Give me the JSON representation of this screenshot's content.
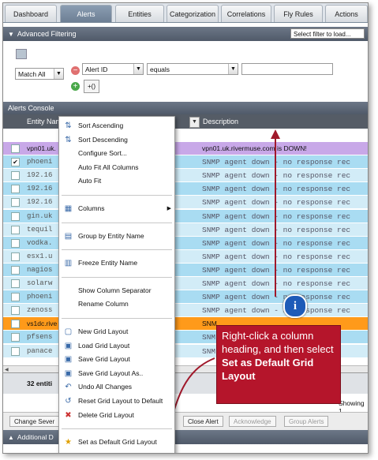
{
  "tabs": [
    "Dashboard",
    "Alerts",
    "Entities",
    "Categorization",
    "Correlations",
    "Fly Rules",
    "Actions"
  ],
  "active_tab": "Alerts",
  "advanced_filtering": {
    "title": "Advanced Filtering",
    "filter_select": "Select filter to load...",
    "match": "Match All",
    "field": "Alert ID",
    "operator": "equals",
    "value": "",
    "group_button": "+()"
  },
  "alerts_console": {
    "title": "Alerts Console",
    "columns": {
      "entity": "Entity Name",
      "description": "Description"
    },
    "rows": [
      {
        "entity": "vpn01.uk.",
        "desc": "vpn01.uk.rivermuse.com is DOWN!",
        "style": "purple",
        "checked": false
      },
      {
        "entity": "phoeni",
        "desc": "SNMP agent down - no response rec",
        "style": "blue",
        "checked": true
      },
      {
        "entity": "192.16",
        "desc": "SNMP agent down - no response rec",
        "style": "light",
        "checked": false
      },
      {
        "entity": "192.16",
        "desc": "SNMP agent down - no response rec",
        "style": "blue",
        "checked": false
      },
      {
        "entity": "192.16",
        "desc": "SNMP agent down - no response rec",
        "style": "light",
        "checked": false
      },
      {
        "entity": "gin.uk",
        "desc": "SNMP agent down - no response rec",
        "style": "blue",
        "checked": false
      },
      {
        "entity": "tequil",
        "desc": "SNMP agent down - no response rec",
        "style": "light",
        "checked": false
      },
      {
        "entity": "vodka.",
        "desc": "SNMP agent down - no response rec",
        "style": "blue",
        "checked": false
      },
      {
        "entity": "esx1.u",
        "desc": "SNMP agent down - no response rec",
        "style": "light",
        "checked": false
      },
      {
        "entity": "nagios",
        "desc": "SNMP agent down - no response rec",
        "style": "blue",
        "checked": false
      },
      {
        "entity": "solarw",
        "desc": "SNMP agent down - no response rec",
        "style": "light",
        "checked": false
      },
      {
        "entity": "phoeni",
        "desc": "SNMP agent down - no response rec",
        "style": "blue",
        "checked": false
      },
      {
        "entity": "zenoss",
        "desc": "SNMP agent down - no response rec",
        "style": "light",
        "checked": false
      },
      {
        "entity": "vs1dc.rive",
        "desc": "SNM",
        "style": "orange",
        "checked": false
      },
      {
        "entity": "pfsens",
        "desc": "SNM",
        "style": "blue",
        "checked": false
      },
      {
        "entity": "panace",
        "desc": "SNM",
        "style": "light",
        "checked": false
      }
    ],
    "entities_count": "32 entiti",
    "showing": "Showing 1"
  },
  "actions": {
    "change_severity": "Change Sever",
    "close_alert": "Close Alert",
    "acknowledge": "Acknowledge",
    "group_alerts": "Group Alerts"
  },
  "additional_bar": "Additional D",
  "context_menu": [
    {
      "label": "Sort Ascending",
      "icon": "sort-ascending-icon",
      "glyph": "⇅"
    },
    {
      "label": "Sort Descending",
      "icon": "sort-descending-icon",
      "glyph": "⇅"
    },
    {
      "label": "Configure Sort...",
      "icon": "",
      "glyph": ""
    },
    {
      "label": "Auto Fit All Columns",
      "icon": "",
      "glyph": ""
    },
    {
      "label": "Auto Fit",
      "icon": "",
      "glyph": ""
    },
    {
      "sep": true
    },
    {
      "label": "Columns",
      "icon": "columns-icon",
      "glyph": "▦",
      "submenu": true
    },
    {
      "sep": true
    },
    {
      "label": "Group by Entity Name",
      "icon": "group-icon",
      "glyph": "▤"
    },
    {
      "sep": true
    },
    {
      "label": "Freeze Entity Name",
      "icon": "freeze-icon",
      "glyph": "▥"
    },
    {
      "sep": true
    },
    {
      "label": "Show Column Separator",
      "icon": "",
      "glyph": ""
    },
    {
      "label": "Rename Column",
      "icon": "",
      "glyph": ""
    },
    {
      "sep": true
    },
    {
      "label": "New Grid Layout",
      "icon": "new-layout-icon",
      "glyph": "▢"
    },
    {
      "label": "Load Grid Layout",
      "icon": "load-layout-icon",
      "glyph": "▣"
    },
    {
      "label": "Save Grid Layout",
      "icon": "save-layout-icon",
      "glyph": "▣"
    },
    {
      "label": "Save Grid Layout As..",
      "icon": "save-as-layout-icon",
      "glyph": "▣"
    },
    {
      "label": "Undo All Changes",
      "icon": "undo-icon",
      "glyph": "↶"
    },
    {
      "label": "Reset Grid Layout to Default",
      "icon": "reset-icon",
      "glyph": "↺"
    },
    {
      "label": "Delete Grid Layout",
      "icon": "delete-icon",
      "glyph": "✖"
    },
    {
      "sep": true
    },
    {
      "label": "Set as Default Grid Layout",
      "icon": "star-icon",
      "glyph": "★"
    }
  ],
  "callout": {
    "line1": "Right-click a column heading, and then select ",
    "bold": "Set as Default Grid Layout",
    "info": "i"
  },
  "colors": {
    "purple_row": "#c8a8e8",
    "orange_row": "#ff9a1a",
    "blue_row": "#a9dcf2",
    "callout": "#b5152b",
    "arrow": "#a0192b"
  }
}
